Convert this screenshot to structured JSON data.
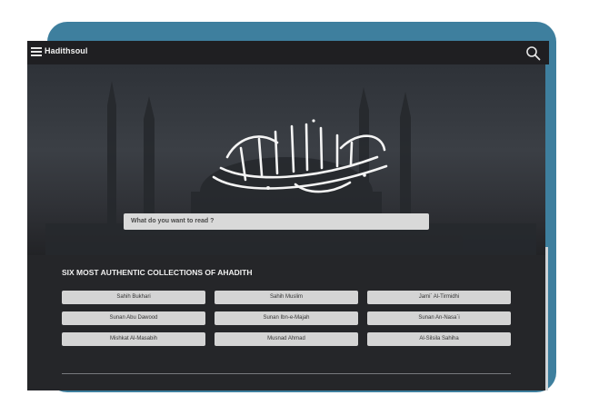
{
  "app": {
    "brand": "Hadithsoul"
  },
  "hero": {
    "search_placeholder": "What do you want to read ?"
  },
  "collections": {
    "title": "SIX MOST AUTHENTIC COLLECTIONS OF AHADITH",
    "items": [
      "Sahih Bukhari",
      "Sahih Muslim",
      "Jami` Al-Tirmidhi",
      "Sunan Abu Dawood",
      "Sunan Ibn-e-Majah",
      "Sunan An-Nasa`i",
      "Mishkat Al-Masabih",
      "Musnad Ahmad",
      "Al-Silsila Sahiha"
    ]
  },
  "colors": {
    "frame": "#3e7f9e",
    "screen": "#232427",
    "button": "#d4d4d4"
  },
  "icons": {
    "menu": "hamburger-menu-icon",
    "search": "search-icon",
    "calligraphy": "bismillah-calligraphy"
  }
}
